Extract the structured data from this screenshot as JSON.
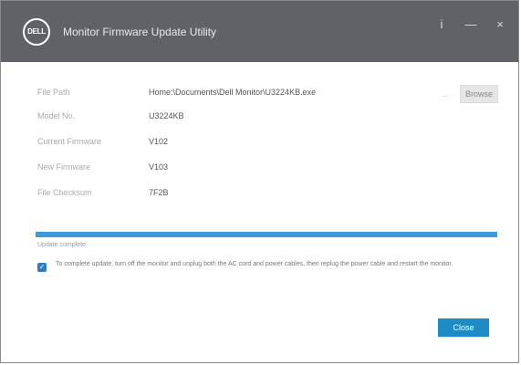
{
  "window": {
    "title": "Monitor Firmware Update Utility",
    "logo_text": "DELL",
    "controls": [
      "i",
      "—",
      "×"
    ]
  },
  "info_rows": [
    {
      "label": "File Path",
      "value": "Home:\\Documents\\Dell Monitor\\U3224KB.exe"
    },
    {
      "label": "Model No.",
      "value": "U3224KB"
    },
    {
      "label": "Current Firmware",
      "value": "V102"
    },
    {
      "label": "New Firmware",
      "value": "V103"
    },
    {
      "label": "File Checksum",
      "value": "7F2B"
    }
  ],
  "browse": {
    "dots": "...",
    "label": "Browse"
  },
  "progress": {
    "fraction": 1.0,
    "status": "Update complete"
  },
  "checkbox": {
    "checked": true,
    "text": "To complete update, turn off the monitor and unplug both the AC cord and power cables, then replug the power cable and restart the monitor."
  },
  "close_button": {
    "label": "Close"
  },
  "colors": {
    "titlebar": "#5f6368",
    "accent": "#1e8cc4",
    "progress": "#3b9ad9"
  }
}
